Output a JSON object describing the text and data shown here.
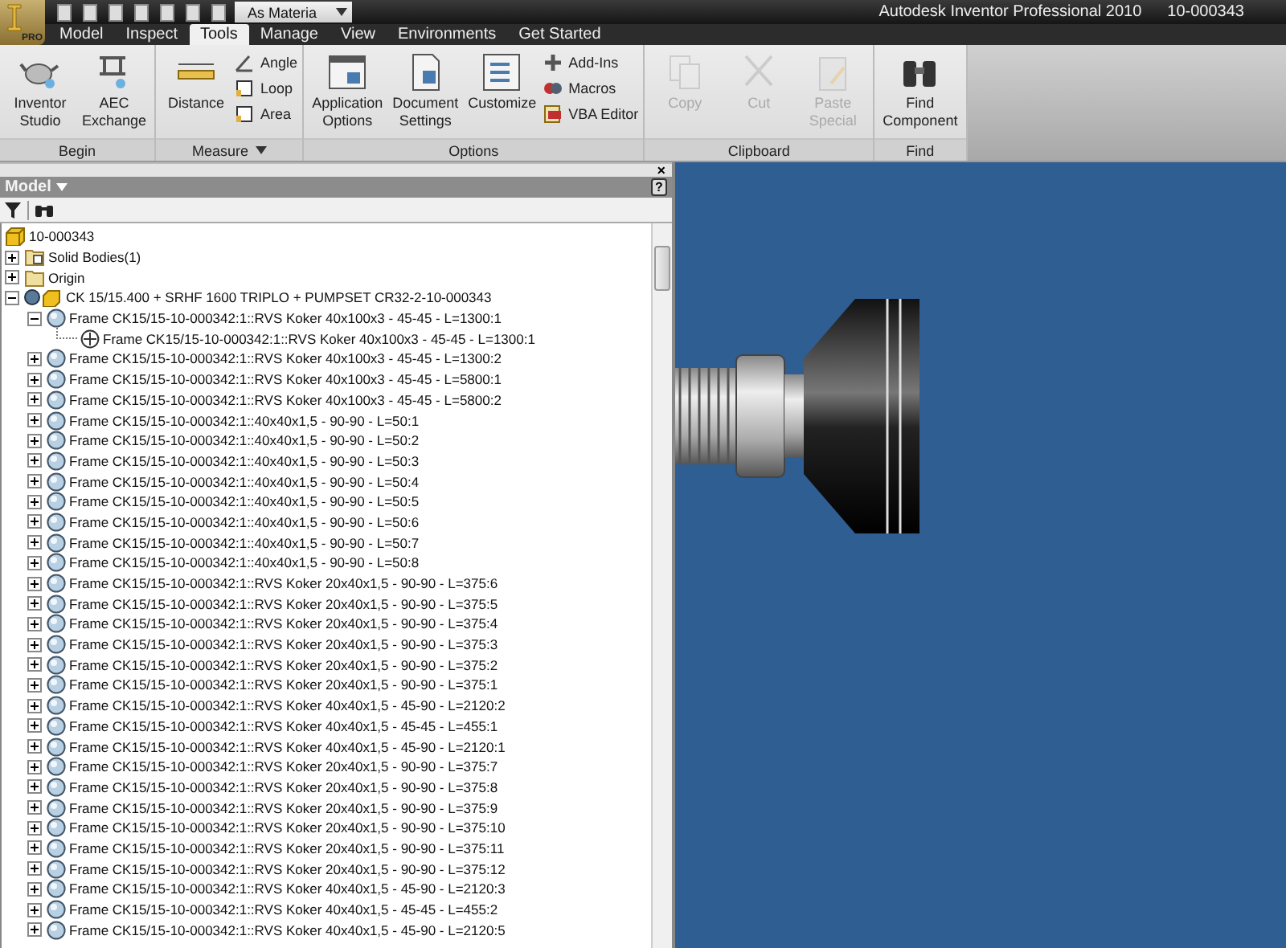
{
  "app": {
    "logo": "PRO",
    "quick_access_combo": "As Materia",
    "title": "Autodesk Inventor Professional 2010",
    "document": "10-000343"
  },
  "tabs": [
    {
      "label": "Model",
      "selected": false
    },
    {
      "label": "Inspect",
      "selected": false
    },
    {
      "label": "Tools",
      "selected": true
    },
    {
      "label": "Manage",
      "selected": false
    },
    {
      "label": "View",
      "selected": false
    },
    {
      "label": "Environments",
      "selected": false
    },
    {
      "label": "Get Started",
      "selected": false
    }
  ],
  "ribbon": [
    {
      "title": "Begin",
      "dropdown": false,
      "tools": [
        {
          "label": "Inventor Studio",
          "kind": "large",
          "disabled": false
        },
        {
          "label": "AEC Exchange",
          "kind": "large",
          "disabled": false
        }
      ]
    },
    {
      "title": "Measure",
      "dropdown": true,
      "tools": [
        {
          "label": "Distance",
          "kind": "large",
          "disabled": false
        },
        {
          "label": "Angle",
          "kind": "small",
          "disabled": false
        },
        {
          "label": "Loop",
          "kind": "small",
          "disabled": false
        },
        {
          "label": "Area",
          "kind": "small",
          "disabled": false
        }
      ]
    },
    {
      "title": "Options",
      "dropdown": false,
      "tools": [
        {
          "label": "Application Options",
          "kind": "large",
          "disabled": false
        },
        {
          "label": "Document Settings",
          "kind": "large",
          "disabled": false
        },
        {
          "label": "Customize",
          "kind": "large",
          "disabled": false
        },
        {
          "label": "Add-Ins",
          "kind": "small",
          "disabled": false
        },
        {
          "label": "Macros",
          "kind": "small",
          "disabled": false
        },
        {
          "label": "VBA Editor",
          "kind": "small",
          "disabled": false
        }
      ]
    },
    {
      "title": "Clipboard",
      "dropdown": false,
      "tools": [
        {
          "label": "Copy",
          "kind": "large",
          "disabled": true
        },
        {
          "label": "Cut",
          "kind": "large",
          "disabled": true
        },
        {
          "label": "Paste Special",
          "kind": "large",
          "disabled": true
        }
      ]
    },
    {
      "title": "Find",
      "dropdown": false,
      "tools": [
        {
          "label": "Find Component",
          "kind": "large",
          "disabled": false
        }
      ]
    }
  ],
  "browser": {
    "close_glyph": "×",
    "title": "Model",
    "help_glyph": "?",
    "tree": [
      {
        "label": "10-000343",
        "kind": "part",
        "children": [
          {
            "label": "Solid Bodies(1)",
            "kind": "bodies",
            "expanded": false
          },
          {
            "label": "Origin",
            "kind": "folder",
            "expanded": false
          },
          {
            "label": "CK 15/15.400 + SRHF 1600 TRIPLO + PUMPSET CR32-2-10-000343",
            "kind": "assembly",
            "expanded": true,
            "children": [
              {
                "label": "Frame CK15/15-10-000342:1::RVS Koker 40x100x3 - 45-45 - L=1300:1",
                "kind": "frame",
                "expanded": true,
                "children": [
                  {
                    "label": "Frame CK15/15-10-000342:1::RVS Koker 40x100x3 - 45-45 - L=1300:1",
                    "kind": "member"
                  }
                ]
              },
              {
                "label": "Frame CK15/15-10-000342:1::RVS Koker 40x100x3 - 45-45 - L=1300:2",
                "kind": "frame",
                "expanded": false
              },
              {
                "label": "Frame CK15/15-10-000342:1::RVS Koker 40x100x3 - 45-45 - L=5800:1",
                "kind": "frame",
                "expanded": false
              },
              {
                "label": "Frame CK15/15-10-000342:1::RVS Koker 40x100x3 - 45-45 - L=5800:2",
                "kind": "frame",
                "expanded": false
              },
              {
                "label": "Frame CK15/15-10-000342:1::40x40x1,5 - 90-90 - L=50:1",
                "kind": "frame",
                "expanded": false
              },
              {
                "label": "Frame CK15/15-10-000342:1::40x40x1,5 - 90-90 - L=50:2",
                "kind": "frame",
                "expanded": false
              },
              {
                "label": "Frame CK15/15-10-000342:1::40x40x1,5 - 90-90 - L=50:3",
                "kind": "frame",
                "expanded": false
              },
              {
                "label": "Frame CK15/15-10-000342:1::40x40x1,5 - 90-90 - L=50:4",
                "kind": "frame",
                "expanded": false
              },
              {
                "label": "Frame CK15/15-10-000342:1::40x40x1,5 - 90-90 - L=50:5",
                "kind": "frame",
                "expanded": false
              },
              {
                "label": "Frame CK15/15-10-000342:1::40x40x1,5 - 90-90 - L=50:6",
                "kind": "frame",
                "expanded": false
              },
              {
                "label": "Frame CK15/15-10-000342:1::40x40x1,5 - 90-90 - L=50:7",
                "kind": "frame",
                "expanded": false
              },
              {
                "label": "Frame CK15/15-10-000342:1::40x40x1,5 - 90-90 - L=50:8",
                "kind": "frame",
                "expanded": false
              },
              {
                "label": "Frame CK15/15-10-000342:1::RVS Koker 20x40x1,5 - 90-90 - L=375:6",
                "kind": "frame",
                "expanded": false
              },
              {
                "label": "Frame CK15/15-10-000342:1::RVS Koker 20x40x1,5 - 90-90 - L=375:5",
                "kind": "frame",
                "expanded": false
              },
              {
                "label": "Frame CK15/15-10-000342:1::RVS Koker 20x40x1,5 - 90-90 - L=375:4",
                "kind": "frame",
                "expanded": false
              },
              {
                "label": "Frame CK15/15-10-000342:1::RVS Koker 20x40x1,5 - 90-90 - L=375:3",
                "kind": "frame",
                "expanded": false
              },
              {
                "label": "Frame CK15/15-10-000342:1::RVS Koker 20x40x1,5 - 90-90 - L=375:2",
                "kind": "frame",
                "expanded": false
              },
              {
                "label": "Frame CK15/15-10-000342:1::RVS Koker 20x40x1,5 - 90-90 - L=375:1",
                "kind": "frame",
                "expanded": false
              },
              {
                "label": "Frame CK15/15-10-000342:1::RVS Koker 40x40x1,5 - 45-90 - L=2120:2",
                "kind": "frame",
                "expanded": false
              },
              {
                "label": "Frame CK15/15-10-000342:1::RVS Koker 40x40x1,5 - 45-45 - L=455:1",
                "kind": "frame",
                "expanded": false
              },
              {
                "label": "Frame CK15/15-10-000342:1::RVS Koker 40x40x1,5 - 45-90 - L=2120:1",
                "kind": "frame",
                "expanded": false
              },
              {
                "label": "Frame CK15/15-10-000342:1::RVS Koker 20x40x1,5 - 90-90 - L=375:7",
                "kind": "frame",
                "expanded": false
              },
              {
                "label": "Frame CK15/15-10-000342:1::RVS Koker 20x40x1,5 - 90-90 - L=375:8",
                "kind": "frame",
                "expanded": false
              },
              {
                "label": "Frame CK15/15-10-000342:1::RVS Koker 20x40x1,5 - 90-90 - L=375:9",
                "kind": "frame",
                "expanded": false
              },
              {
                "label": "Frame CK15/15-10-000342:1::RVS Koker 20x40x1,5 - 90-90 - L=375:10",
                "kind": "frame",
                "expanded": false
              },
              {
                "label": "Frame CK15/15-10-000342:1::RVS Koker 20x40x1,5 - 90-90 - L=375:11",
                "kind": "frame",
                "expanded": false
              },
              {
                "label": "Frame CK15/15-10-000342:1::RVS Koker 20x40x1,5 - 90-90 - L=375:12",
                "kind": "frame",
                "expanded": false
              },
              {
                "label": "Frame CK15/15-10-000342:1::RVS Koker 40x40x1,5 - 45-90 - L=2120:3",
                "kind": "frame",
                "expanded": false
              },
              {
                "label": "Frame CK15/15-10-000342:1::RVS Koker 40x40x1,5 - 45-45 - L=455:2",
                "kind": "frame",
                "expanded": false
              },
              {
                "label": "Frame CK15/15-10-000342:1::RVS Koker 40x40x1,5 - 45-90 - L=2120:5",
                "kind": "frame",
                "expanded": false
              }
            ]
          }
        ]
      }
    ]
  }
}
